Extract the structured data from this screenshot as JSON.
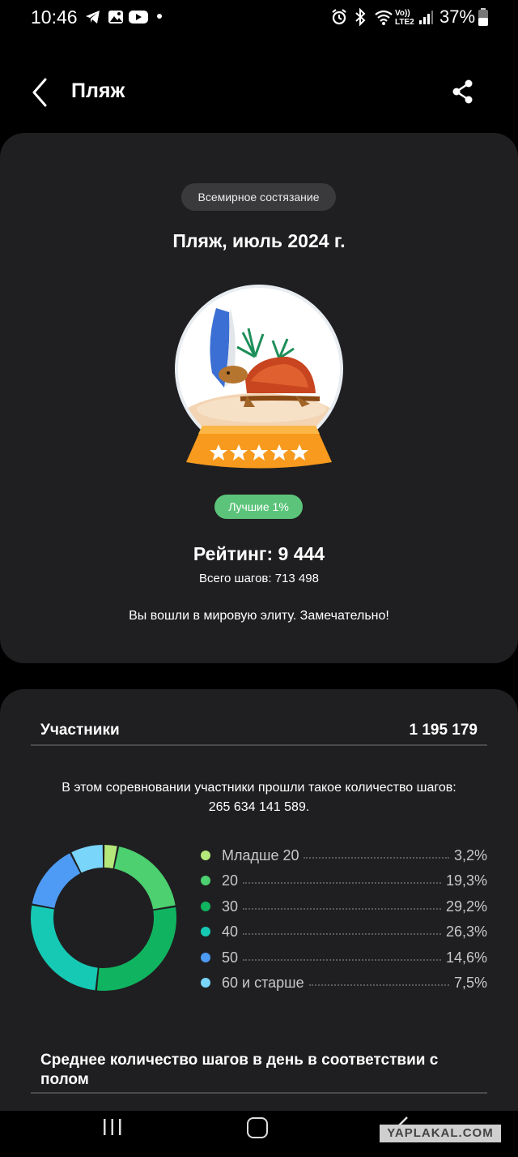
{
  "status_bar": {
    "time": "10:46",
    "network": "Vo)) LTE2",
    "battery": "37%"
  },
  "header": {
    "title": "Пляж"
  },
  "challenge": {
    "tag": "Всемирное состязание",
    "title": "Пляж, июль 2024 г.",
    "rank_badge": "Лучшие 1%",
    "rating": "Рейтинг: 9 444",
    "total_steps": "Всего шагов: 713 498",
    "message": "Вы вошли в мировую элиту. Замечательно!"
  },
  "participants": {
    "label": "Участники",
    "count": "1 195 179",
    "description_line1": "В этом соревновании участники прошли такое количество шагов:",
    "description_line2": "265 634 141 589."
  },
  "chart_data": {
    "type": "pie",
    "donut": true,
    "categories": [
      "Младше 20",
      "20",
      "30",
      "40",
      "50",
      "60 и старше"
    ],
    "values": [
      3.2,
      19.3,
      29.2,
      26.3,
      14.6,
      7.5
    ],
    "value_labels": [
      "3,2%",
      "19,3%",
      "29,2%",
      "26,3%",
      "14,6%",
      "7,5%"
    ],
    "colors": [
      "#b5e87a",
      "#4cd070",
      "#10b460",
      "#16c9b4",
      "#4d9bf5",
      "#79d5fa"
    ],
    "legend_position": "right"
  },
  "average": {
    "title": "Среднее количество шагов в день в соответствии с полом"
  },
  "watermark": "YAPLAKAL.COM",
  "icons": {
    "back": "chevron-left-icon",
    "share": "share-icon",
    "recent_apps": "recent-apps-icon",
    "home": "home-icon",
    "nav_back": "nav-back-icon"
  }
}
